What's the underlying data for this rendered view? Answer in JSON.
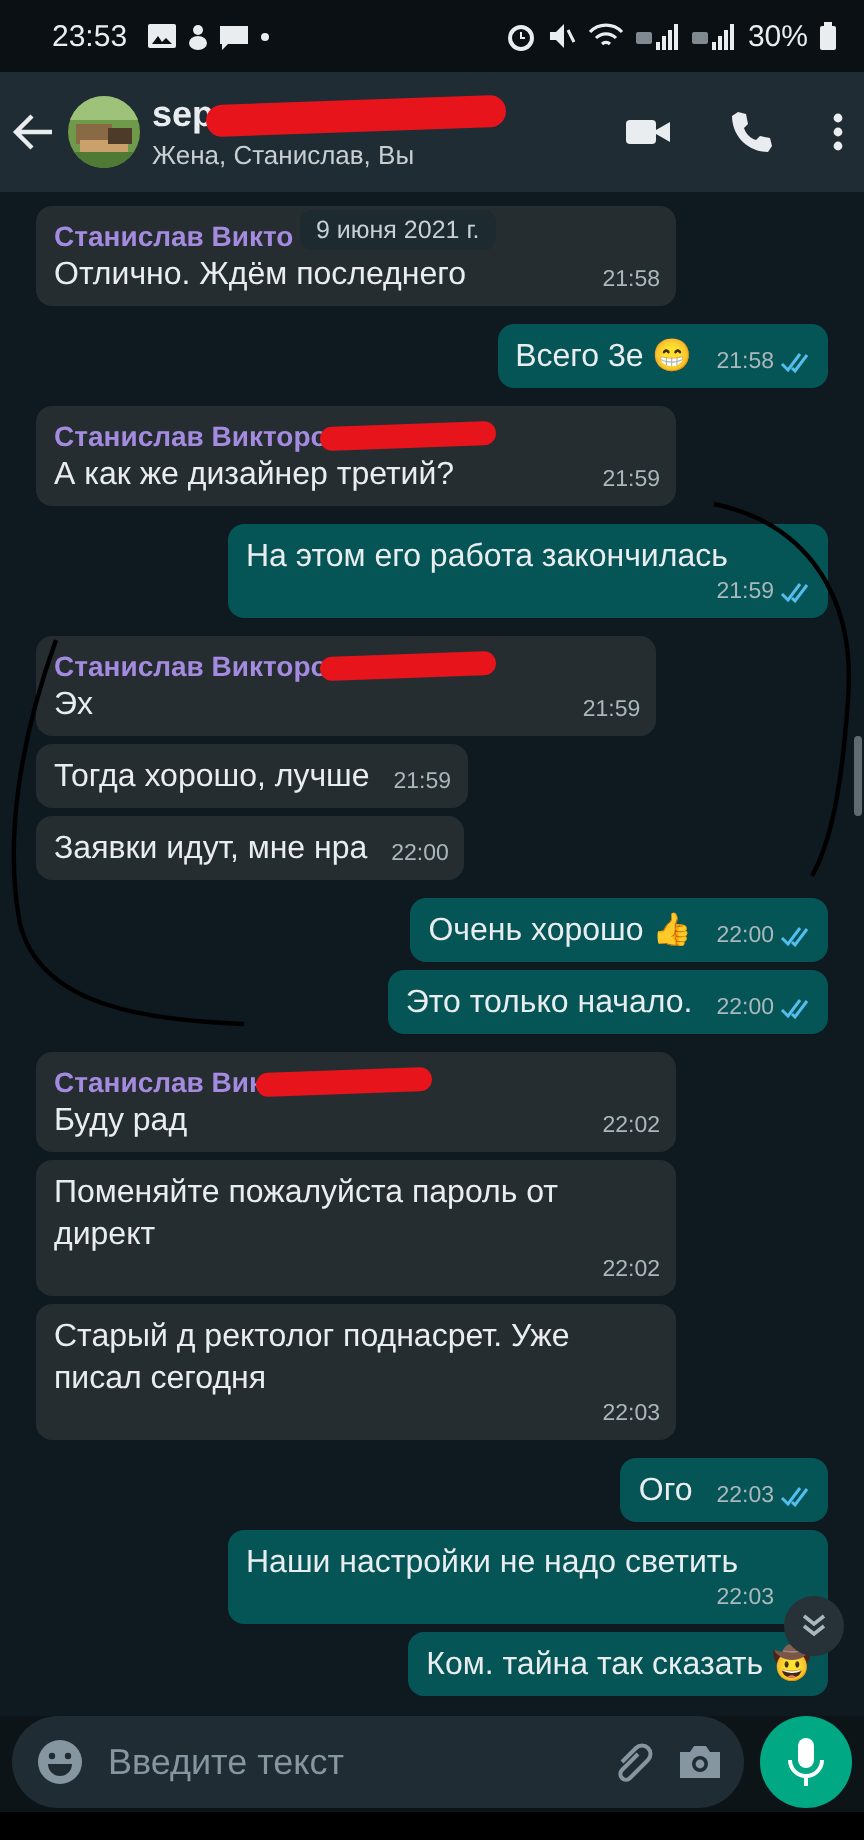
{
  "status_bar": {
    "time": "23:53",
    "battery": "30%"
  },
  "header": {
    "title": "sep",
    "title_redacted": true,
    "subtitle": "Жена, Станислав, Вы"
  },
  "date_chip": "9 июня 2021 г.",
  "messages": [
    {
      "kind": "incoming",
      "sender": "Станислав Викто",
      "sender_redacted": false,
      "text": "Отлично. Ждём последнего",
      "time": "21:58"
    },
    {
      "kind": "outgoing",
      "text": "Всего 3е 😁",
      "time": "21:58",
      "read": true
    },
    {
      "kind": "incoming",
      "sender": "Станислав Викторо",
      "sender_redacted": true,
      "text": "А как же дизайнер третий?",
      "time": "21:59"
    },
    {
      "kind": "outgoing",
      "text": "На этом его работа закончилась",
      "time": "21:59",
      "read": true
    },
    {
      "kind": "incoming",
      "sender": "Станислав Викторо",
      "sender_redacted": true,
      "text": "Эх",
      "time": "21:59"
    },
    {
      "kind": "incoming",
      "text": "Тогда хорошо, лучше",
      "time": "21:59"
    },
    {
      "kind": "incoming",
      "text": "Заявки идут, мне нра",
      "time": "22:00"
    },
    {
      "kind": "outgoing",
      "text": "Очень хорошо 👍",
      "time": "22:00",
      "read": true
    },
    {
      "kind": "outgoing",
      "text": "Это только начало.",
      "time": "22:00",
      "read": true
    },
    {
      "kind": "incoming",
      "sender": "Станислав Вик",
      "sender_redacted": true,
      "text": "Буду рад",
      "time": "22:02"
    },
    {
      "kind": "incoming",
      "text": "Поменяйте пожалуйста пароль от директ",
      "time": "22:02"
    },
    {
      "kind": "incoming",
      "text": "Старый д ректолог поднасрет. Уже писал сегодня",
      "time": "22:03"
    },
    {
      "kind": "outgoing",
      "text": "Ого",
      "time": "22:03",
      "read": true
    },
    {
      "kind": "outgoing",
      "text": "Наши настройки не надо светить",
      "time": "22:03",
      "read": false
    },
    {
      "kind": "outgoing",
      "text": "Ком. тайна так сказать 🤠"
    }
  ],
  "input": {
    "placeholder": "Введите текст"
  }
}
